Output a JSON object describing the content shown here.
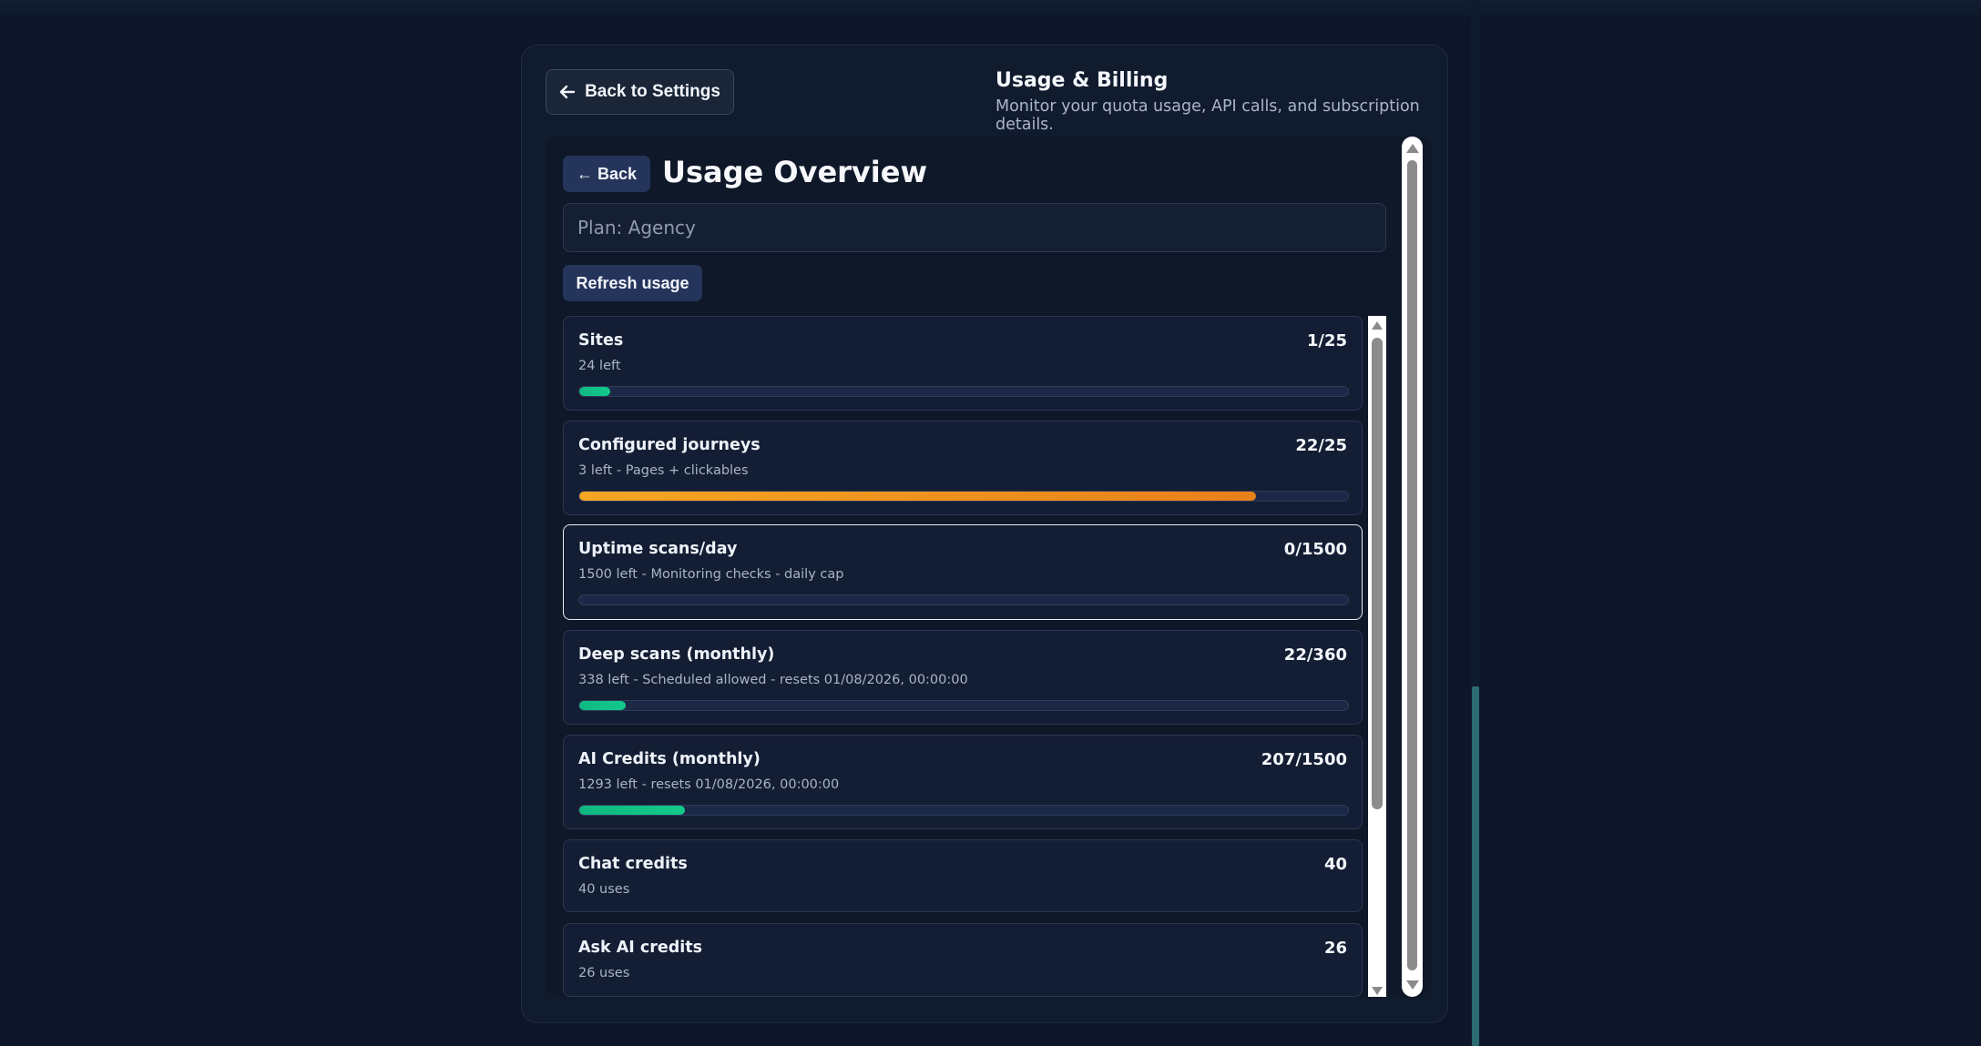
{
  "header": {
    "back_label": "Back to Settings",
    "title": "Usage & Billing",
    "subtitle": "Monitor your quota usage, API calls, and subscription details."
  },
  "overview": {
    "back_label": "← Back",
    "title": "Usage Overview",
    "plan_value": "Plan: Agency",
    "refresh_label": "Refresh usage"
  },
  "colors": {
    "green": "#10b981",
    "orange": "#f29a1d",
    "panel": "#111b2e",
    "track": "#1c2946"
  },
  "cards": [
    {
      "title": "Sites",
      "value": "1/25",
      "sub": "24 left",
      "progress": 0.04,
      "bar": "green"
    },
    {
      "title": "Configured journeys",
      "value": "22/25",
      "sub": "3 left - Pages + clickables",
      "progress": 0.88,
      "bar": "orange"
    },
    {
      "title": "Uptime scans/day",
      "value": "0/1500",
      "sub": "1500 left - Monitoring checks - daily cap",
      "progress": 0.0,
      "bar": "green",
      "focused": true
    },
    {
      "title": "Deep scans (monthly)",
      "value": "22/360",
      "sub": "338 left - Scheduled allowed - resets 01/08/2026, 00:00:00",
      "progress": 0.061,
      "bar": "green"
    },
    {
      "title": "AI Credits (monthly)",
      "value": "207/1500",
      "sub": "1293 left - resets 01/08/2026, 00:00:00",
      "progress": 0.138,
      "bar": "green"
    },
    {
      "title": "Chat credits",
      "value": "40",
      "sub": "40 uses"
    },
    {
      "title": "Ask AI credits",
      "value": "26",
      "sub": "26 uses"
    }
  ]
}
